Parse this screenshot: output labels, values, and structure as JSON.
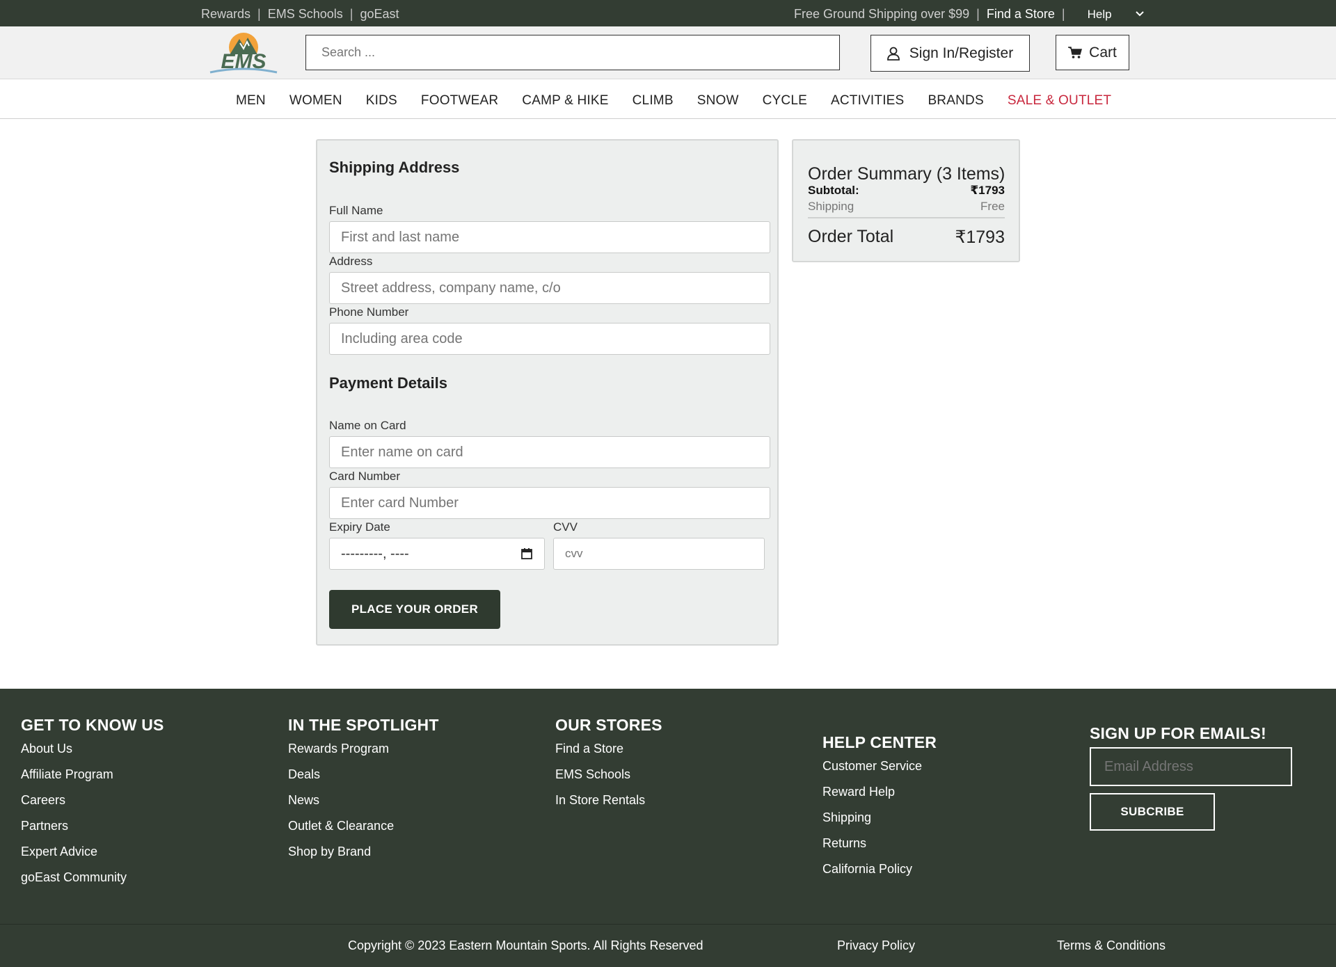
{
  "topbar": {
    "links": [
      "Rewards",
      "EMS Schools",
      "goEast"
    ],
    "shipping_promo": "Free Ground Shipping over $99",
    "find_store": "Find a Store",
    "help": "Help",
    "help_icon": "chevron-down-icon"
  },
  "header": {
    "logo_text": "EMS",
    "search_placeholder": "Search ...",
    "signin_label": "Sign In/Register",
    "signin_icon": "user-icon",
    "cart_label": "Cart",
    "cart_icon": "cart-icon"
  },
  "nav": {
    "items": [
      "MEN",
      "WOMEN",
      "KIDS",
      "FOOTWEAR",
      "CAMP & HIKE",
      "CLIMB",
      "SNOW",
      "CYCLE",
      "ACTIVITIES",
      "BRANDS",
      "SALE & OUTLET"
    ],
    "sale_color": "#c8273d"
  },
  "shipping": {
    "title": "Shipping Address",
    "full_name_label": "Full Name",
    "full_name_placeholder": "First and last name",
    "address_label": "Address",
    "address_placeholder": "Street address, company name, c/o",
    "phone_label": "Phone Number",
    "phone_placeholder": "Including area code"
  },
  "payment": {
    "title": "Payment Details",
    "name_label": "Name on Card",
    "name_placeholder": "Enter name on card",
    "card_label": "Card Number",
    "card_placeholder": "Enter card Number",
    "expiry_label": "Expiry Date",
    "expiry_value": "---------, ----",
    "expiry_icon": "calendar-icon",
    "cvv_label": "CVV",
    "cvv_placeholder": "cvv",
    "place_order": "PLACE YOUR ORDER"
  },
  "summary": {
    "title": "Order Summary (3 Items)",
    "subtotal_label": "Subtotal:",
    "subtotal_value": "₹1793",
    "shipping_label": "Shipping",
    "shipping_value": "Free",
    "total_label": "Order Total",
    "total_value": "₹1793"
  },
  "footer": {
    "col1": {
      "title": "GET TO KNOW US",
      "links": [
        "About Us",
        "Affiliate Program",
        "Careers",
        "Partners",
        "Expert Advice",
        "goEast Community"
      ]
    },
    "col2": {
      "title": "IN THE SPOTLIGHT",
      "links": [
        "Rewards Program",
        "Deals",
        "News",
        "Outlet & Clearance",
        "Shop by Brand"
      ]
    },
    "col3": {
      "title": "OUR STORES",
      "links": [
        "Find a Store",
        "EMS Schools",
        "In Store Rentals"
      ]
    },
    "col4": {
      "title": "HELP CENTER",
      "links": [
        "Customer Service",
        "Reward Help",
        "Shipping",
        "Returns",
        "California Policy"
      ]
    },
    "signup": {
      "title": "SIGN UP FOR EMAILS!",
      "email_placeholder": "Email Address",
      "button": "SUBCRIBE"
    },
    "copyright": "Copyright © 2023 Eastern Mountain Sports. All Rights Reserved",
    "privacy": "Privacy Policy",
    "terms": "Terms & Conditions"
  },
  "colors": {
    "dark_green": "#333d33",
    "button_dark": "#2f3a2f",
    "logo_green": "#4a6b52",
    "logo_orange": "#f2a23a",
    "panel_bg": "#edefee"
  }
}
